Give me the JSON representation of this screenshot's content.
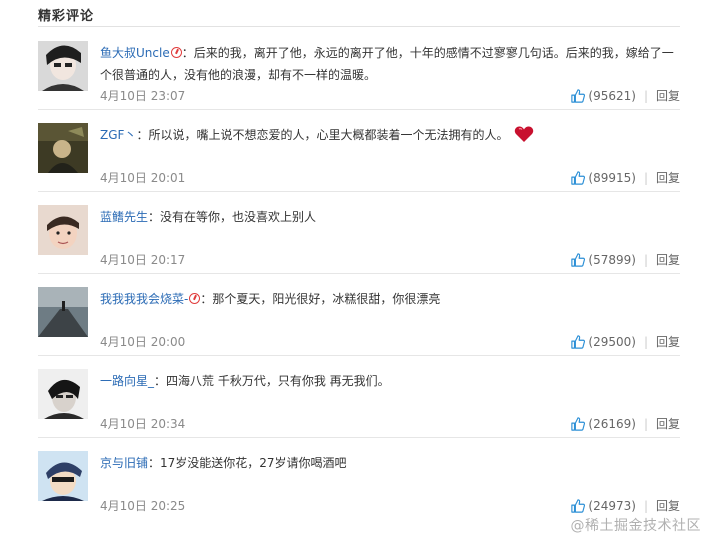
{
  "section": {
    "title": "精彩评论"
  },
  "comments": [
    {
      "user": "鱼大叔Uncle",
      "has_badge": true,
      "text": "：后来的我，离开了他，永远的离开了他，十年的感情不过寥寥几句话。后来的我，嫁给了一个很普通的人，没有他的浪漫，却有不一样的温暖。",
      "time": "4月10日 23:07",
      "likes": "(95621)",
      "reply": "回复"
    },
    {
      "user": "ZGF丶",
      "has_badge": false,
      "text": "：所以说，嘴上说不想恋爱的人，心里大概都装着一个无法拥有的人。",
      "emoji": "heart",
      "time": "4月10日 20:01",
      "likes": "(89915)",
      "reply": "回复"
    },
    {
      "user": "蓝鳍先生",
      "has_badge": false,
      "text": "：没有在等你，也没喜欢上别人",
      "time": "4月10日 20:17",
      "likes": "(57899)",
      "reply": "回复"
    },
    {
      "user": "我我我我会烧菜-",
      "has_badge": true,
      "text": "：那个夏天，阳光很好，冰糕很甜，你很漂亮",
      "time": "4月10日 20:00",
      "likes": "(29500)",
      "reply": "回复"
    },
    {
      "user": "一路向星_",
      "has_badge": false,
      "text": "：四海八荒 千秋万代，只有你我 再无我们。",
      "time": "4月10日 20:34",
      "likes": "(26169)",
      "reply": "回复"
    },
    {
      "user": "京与旧铺",
      "has_badge": false,
      "text": "：17岁没能送你花，27岁请你喝酒吧",
      "time": "4月10日 20:25",
      "likes": "(24973)",
      "reply": "回复"
    }
  ],
  "watermark": "@稀土掘金技术社区",
  "colors": {
    "username": "#2b6bb5",
    "body_text": "#333333",
    "meta_text": "#8a8a8a",
    "badge": "#e03c3c",
    "heart": "#c8102e",
    "thumb_icon": "#2b8fd6"
  },
  "icons": {
    "like": "thumbs-up-icon",
    "badge": "verified-badge-icon",
    "emoji": "heart-icon"
  }
}
